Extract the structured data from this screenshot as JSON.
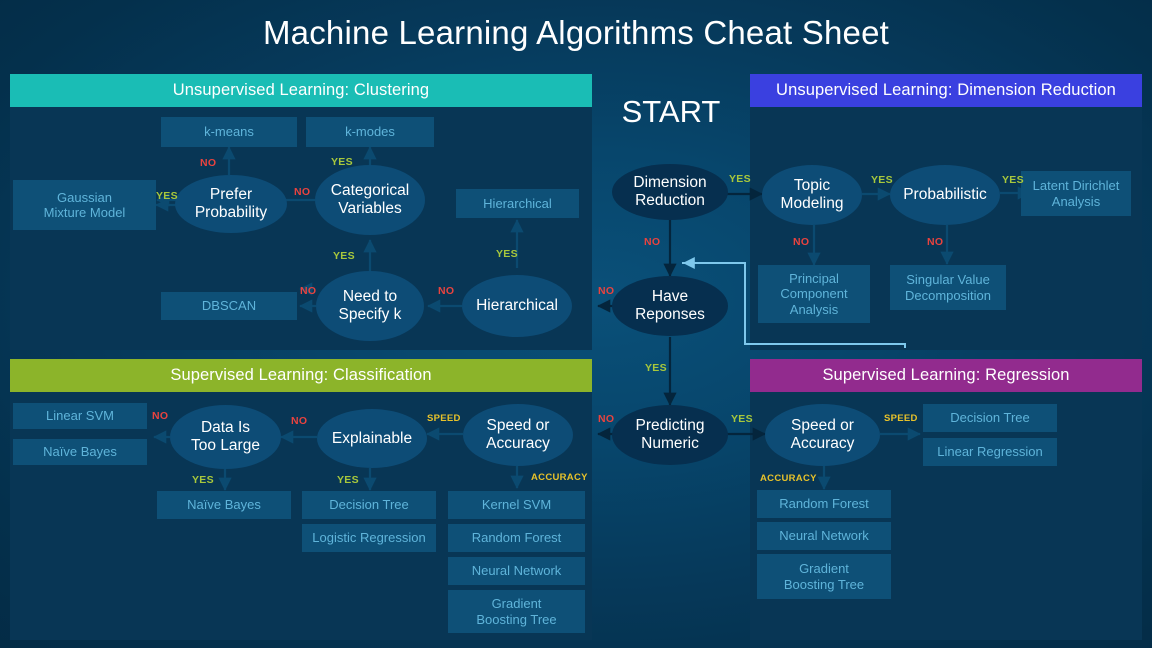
{
  "title": "Machine Learning Algorithms Cheat Sheet",
  "start_label": "START",
  "colors": {
    "clustering": "#1abdb5",
    "dimension_reduction": "#3a40e0",
    "classification": "#8cb42a",
    "regression": "#922b8e",
    "yes": "#a8c83c",
    "no": "#e8433f",
    "speed_accuracy": "#e8c22a",
    "box_fill": "#0e5077",
    "box_text": "#5fb4da",
    "ellipse_fill": "#0d4c76",
    "background": "#04304c"
  },
  "center": {
    "nodes": {
      "dimension_reduction": "Dimension\nReduction",
      "have_responses": "Have\nReponses",
      "predicting_numeric": "Predicting\nNumeric"
    },
    "labels": {
      "dr_yes": "YES",
      "dr_no": "NO",
      "hr_no": "NO",
      "hr_yes": "YES",
      "pn_no": "NO",
      "pn_yes": "YES"
    }
  },
  "clustering": {
    "header": "Unsupervised Learning: Clustering",
    "decisions": {
      "prefer_probability": "Prefer\nProbability",
      "categorical_variables": "Categorical\nVariables",
      "need_to_specify_k": "Need to\nSpecify k",
      "hierarchical": "Hierarchical"
    },
    "outcomes": {
      "k_means": "k-means",
      "k_modes": "k-modes",
      "gaussian_mixture_model": "Gaussian\nMixture Model",
      "hierarchical": "Hierarchical",
      "dbscan": "DBSCAN"
    },
    "labels": {
      "pp_no": "NO",
      "pp_yes": "YES",
      "cv_yes": "YES",
      "cv_no": "NO",
      "nk_yes": "YES",
      "nk_no": "NO",
      "hi_yes": "YES",
      "hi_no": "NO"
    }
  },
  "dimension_reduction": {
    "header": "Unsupervised Learning: Dimension Reduction",
    "decisions": {
      "topic_modeling": "Topic\nModeling",
      "probabilistic": "Probabilistic"
    },
    "outcomes": {
      "latent_dirichlet_analysis": "Latent Dirichlet\nAnalysis",
      "principal_component_analysis": "Principal\nComponent\nAnalysis",
      "singular_value_decomposition": "Singular Value\nDecomposition"
    },
    "labels": {
      "tm_yes": "YES",
      "tm_no": "NO",
      "pr_yes": "YES",
      "pr_no": "NO"
    }
  },
  "classification": {
    "header": "Supervised Learning: Classification",
    "decisions": {
      "data_is_too_large": "Data Is\nToo Large",
      "explainable": "Explainable",
      "speed_or_accuracy": "Speed or\nAccuracy"
    },
    "outcomes": {
      "linear_svm": "Linear SVM",
      "naive_bayes_no": "Naïve Bayes",
      "naive_bayes_yes": "Naïve Bayes",
      "decision_tree": "Decision Tree",
      "logistic_regression": "Logistic Regression",
      "kernel_svm": "Kernel SVM",
      "random_forest": "Random Forest",
      "neural_network": "Neural Network",
      "gradient_boosting_tree": "Gradient\nBoosting Tree"
    },
    "labels": {
      "dtl_no": "NO",
      "dtl_yes": "YES",
      "ex_no": "NO",
      "ex_yes": "YES",
      "sa_speed": "SPEED",
      "sa_accuracy": "ACCURACY"
    }
  },
  "regression": {
    "header": "Supervised Learning: Regression",
    "decisions": {
      "speed_or_accuracy": "Speed or\nAccuracy"
    },
    "outcomes": {
      "decision_tree": "Decision Tree",
      "linear_regression": "Linear Regression",
      "random_forest": "Random Forest",
      "neural_network": "Neural Network",
      "gradient_boosting_tree": "Gradient\nBoosting Tree"
    },
    "labels": {
      "sa_speed": "SPEED",
      "sa_accuracy": "ACCURACY"
    }
  }
}
